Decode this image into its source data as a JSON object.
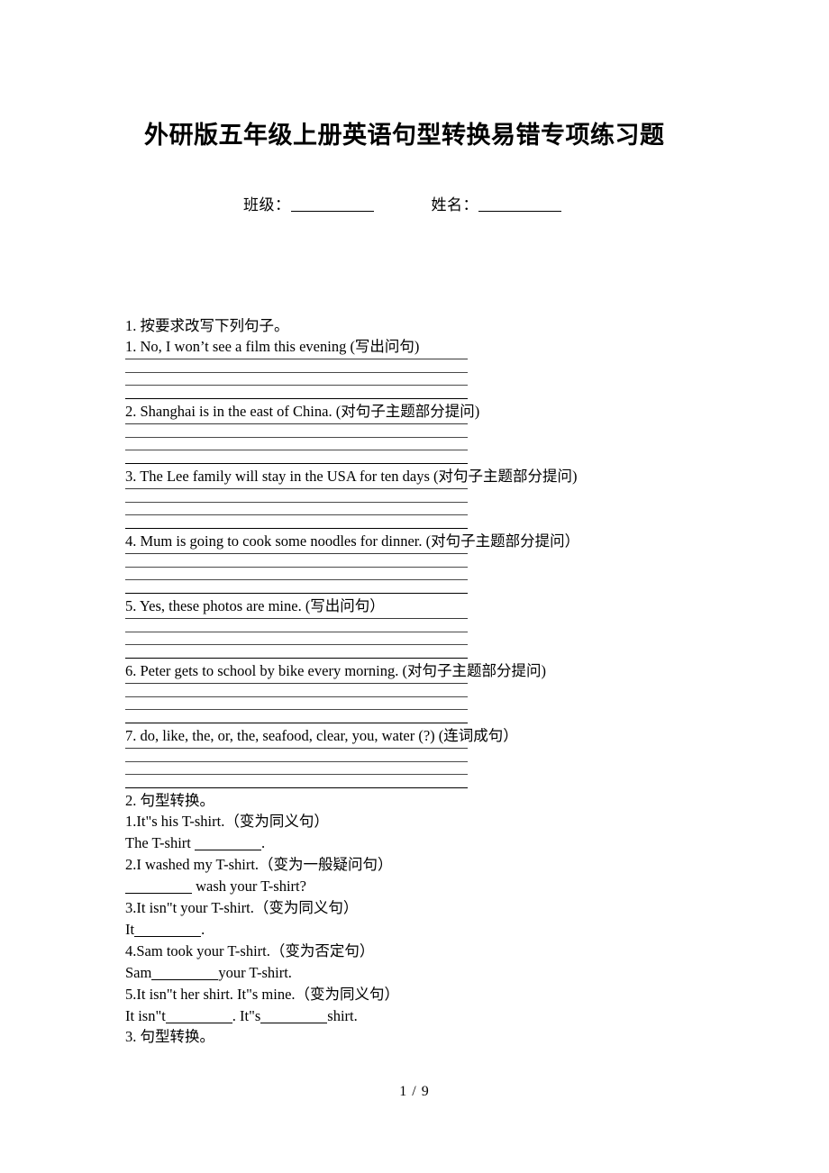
{
  "document": {
    "title": "外研版五年级上册英语句型转换易错专项练习题",
    "page_footer": "1 / 9"
  },
  "student_info": {
    "class_label": "班级：",
    "name_label": "姓名："
  },
  "sections": [
    {
      "heading": "1. 按要求改写下列句子。",
      "questions": [
        "1. No, I won’t see a film this evening (写出问句)",
        "2. Shanghai is in the east of China. (对句子主题部分提问)",
        "3. The Lee family will stay in the USA for ten days (对句子主题部分提问)",
        "4. Mum is going to cook some noodles for dinner. (对句子主题部分提问）",
        "5. Yes, these photos are mine. (写出问句）",
        "6. Peter gets to school by bike every morning. (对句子主题部分提问)",
        "7. do, like, the, or, the, seafood, clear, you, water (?) (连词成句）"
      ]
    },
    {
      "heading": "2. 句型转换。",
      "items": [
        {
          "prompt": "1.It\"s his T-shirt.（变为同义句）",
          "answer_pre": "The T-shirt ",
          "answer_post": "."
        },
        {
          "prompt": "2.I washed my T-shirt.（变为一般疑问句）",
          "answer_pre": "",
          "answer_post": " wash your T-shirt?"
        },
        {
          "prompt": "3.It isn\"t your T-shirt.（变为同义句）",
          "answer_pre": "It",
          "answer_post": "."
        },
        {
          "prompt": "4.Sam took your T-shirt.（变为否定句）",
          "answer_pre": "Sam",
          "answer_post": "your T-shirt."
        },
        {
          "prompt": "5.It isn\"t her shirt. It\"s mine.（变为同义句）",
          "answer_pre": "It isn\"t",
          "answer_mid": ". It\"s",
          "answer_post": "shirt."
        }
      ]
    },
    {
      "heading": "3. 句型转换。"
    }
  ]
}
